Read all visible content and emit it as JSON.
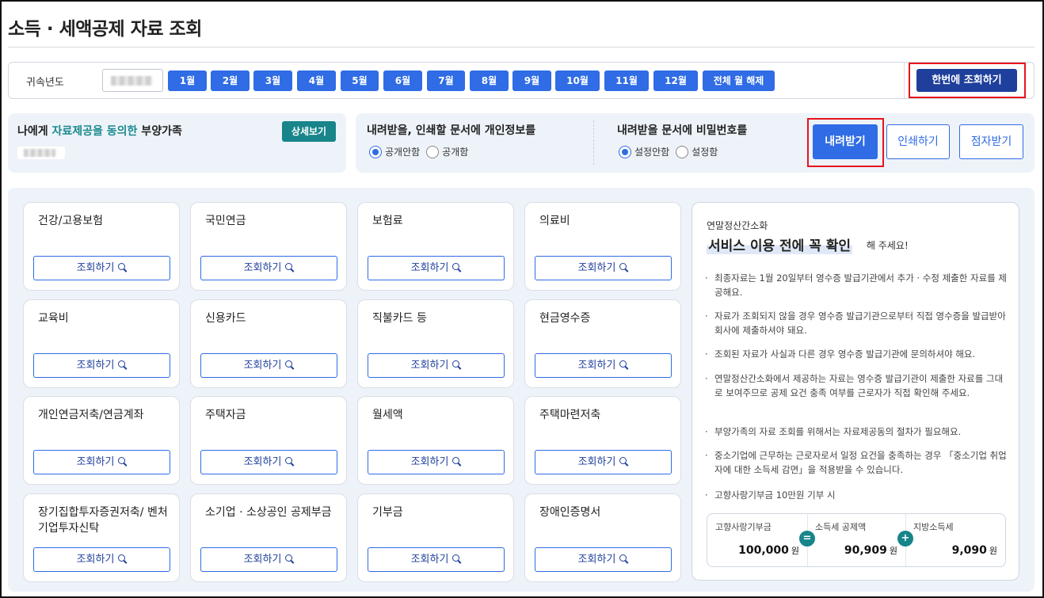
{
  "page": {
    "title": "소득 · 세액공제 자료 조회"
  },
  "year_bar": {
    "label": "귀속년도",
    "months": [
      "1월",
      "2월",
      "3월",
      "4월",
      "5월",
      "6월",
      "7월",
      "8월",
      "9월",
      "10월",
      "11월",
      "12월",
      "전체 월 해제"
    ],
    "lookup_all": "한번에 조회하기"
  },
  "dependents": {
    "title_prefix": "나에게 ",
    "title_highlight": "자료제공을 동의한",
    "title_suffix": " 부양가족",
    "detail_button": "상세보기"
  },
  "personal_info": {
    "title": "내려받을, 인쇄할 문서에 개인정보를",
    "options": [
      "공개안함",
      "공개함"
    ],
    "selected": "공개안함"
  },
  "password": {
    "title": "내려받을 문서에 비밀번호를",
    "options": [
      "설정안함",
      "설정함"
    ],
    "selected": "설정안함"
  },
  "actions": {
    "download": "내려받기",
    "print": "인쇄하기",
    "e_receive": "점자받기"
  },
  "lookup_label": "조회하기",
  "cards": [
    {
      "title": "건강/고용보험"
    },
    {
      "title": "국민연금"
    },
    {
      "title": "보험료"
    },
    {
      "title": "의료비"
    },
    {
      "title": "교육비"
    },
    {
      "title": "신용카드"
    },
    {
      "title": "직불카드 등"
    },
    {
      "title": "현금영수증"
    },
    {
      "title": "개인연금저축/연금계좌"
    },
    {
      "title": "주택자금"
    },
    {
      "title": "월세액"
    },
    {
      "title": "주택마련저축"
    },
    {
      "title": "장기집합투자증권저축/ 벤처기업투자신탁"
    },
    {
      "title": "소기업 · 소상공인 공제부금"
    },
    {
      "title": "기부금"
    },
    {
      "title": "장애인증명서"
    }
  ],
  "notice": {
    "subtitle": "연말정산간소화",
    "headline": "서비스 이용 전에 꼭 확인",
    "headline_tail": "해 주세요!",
    "items": [
      "최종자료는 1월 20일부터 영수증 발급기관에서 추가 · 수정 제출한 자료를 제공해요.",
      "자료가 조회되지 않을 경우 영수증 발급기관으로부터 직접 영수증을 발급받아 회사에 제출하셔야 돼요.",
      "조회된 자료가 사실과 다른 경우 영수증 발급기관에 문의하셔야 해요.",
      "연말정산간소화에서 제공하는 자료는 영수증 발급기관이 제출한 자료를 그대로 보여주므로 공제 요건 충족 여부를 근로자가 직접 확인해 주세요.",
      "부양가족의 자료 조회를 위해서는 자료제공동의 절차가 필요해요.",
      "중소기업에 근무하는 근로자로서 일정 요건을 충족하는 경우 「중소기업 취업자에 대한 소득세 감면」을 적용받을 수 있습니다.",
      "고향사랑기부금 10만원 기부 시"
    ],
    "calc": {
      "col1_label": "고향사랑기부금",
      "col1_value": "100,000",
      "col2_label": "소득세 공제액",
      "col2_value": "90,909",
      "col3_label": "지방소득세",
      "col3_value": "9,090",
      "unit": "원",
      "op_equals": "=",
      "op_plus": "+"
    }
  }
}
